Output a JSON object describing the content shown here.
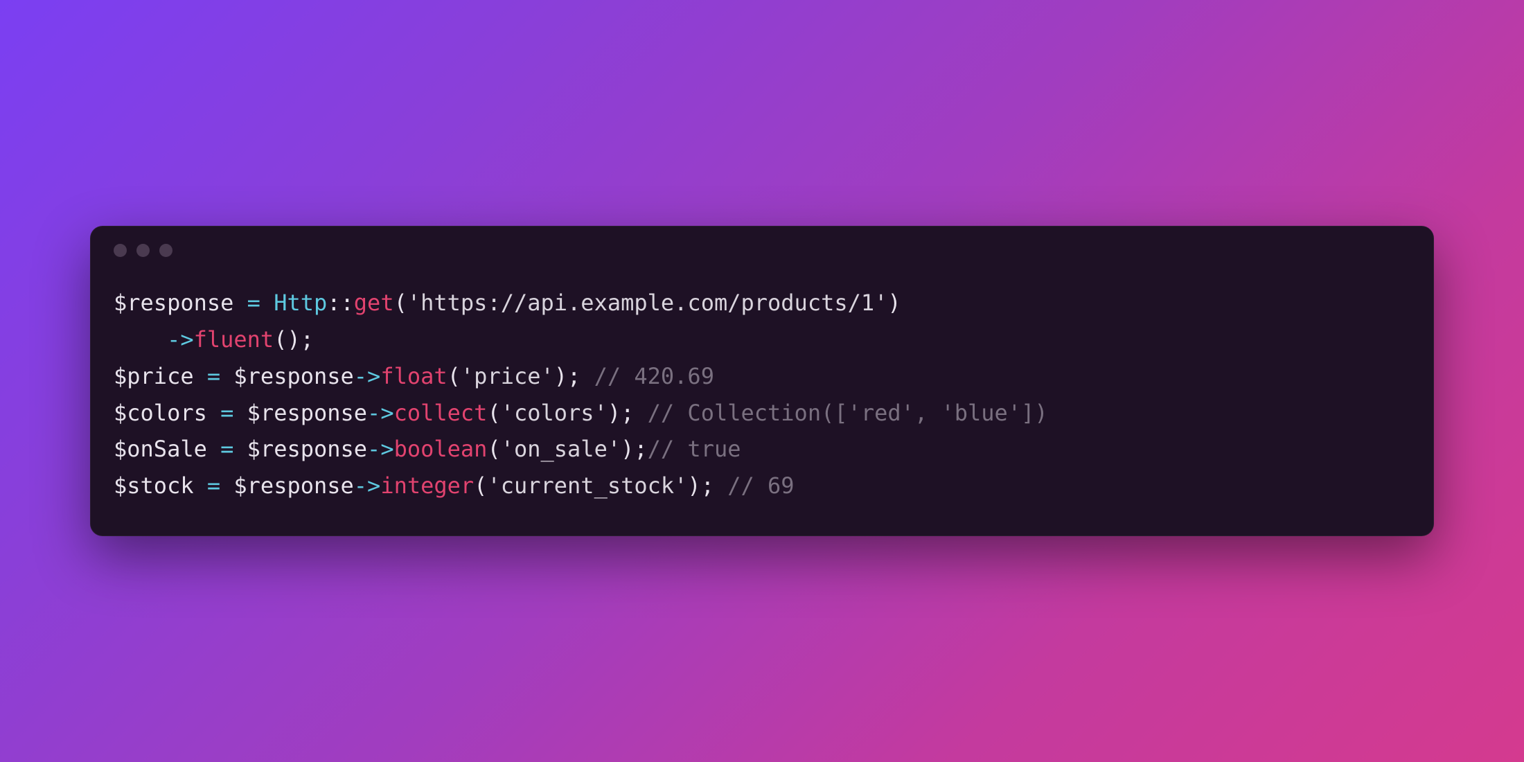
{
  "code": {
    "lines": [
      {
        "indent": "",
        "segments": [
          {
            "cls": "tok-var",
            "t": "$response"
          },
          {
            "cls": "tok-punct",
            "t": " "
          },
          {
            "cls": "tok-op",
            "t": "="
          },
          {
            "cls": "tok-punct",
            "t": " "
          },
          {
            "cls": "tok-class",
            "t": "Http"
          },
          {
            "cls": "tok-punct",
            "t": "::"
          },
          {
            "cls": "tok-method",
            "t": "get"
          },
          {
            "cls": "tok-punct",
            "t": "("
          },
          {
            "cls": "tok-string",
            "t": "'https://api.example.com/products/1'"
          },
          {
            "cls": "tok-punct",
            "t": ")"
          }
        ]
      },
      {
        "indent": "    ",
        "segments": [
          {
            "cls": "tok-op",
            "t": "->"
          },
          {
            "cls": "tok-method",
            "t": "fluent"
          },
          {
            "cls": "tok-punct",
            "t": "();"
          }
        ]
      },
      {
        "indent": "",
        "segments": [
          {
            "cls": "tok-var",
            "t": "$price"
          },
          {
            "cls": "tok-punct",
            "t": " "
          },
          {
            "cls": "tok-op",
            "t": "="
          },
          {
            "cls": "tok-punct",
            "t": " "
          },
          {
            "cls": "tok-var",
            "t": "$response"
          },
          {
            "cls": "tok-op",
            "t": "->"
          },
          {
            "cls": "tok-method",
            "t": "float"
          },
          {
            "cls": "tok-punct",
            "t": "("
          },
          {
            "cls": "tok-string",
            "t": "'price'"
          },
          {
            "cls": "tok-punct",
            "t": "); "
          },
          {
            "cls": "tok-comment",
            "t": "// 420.69"
          }
        ]
      },
      {
        "indent": "",
        "segments": [
          {
            "cls": "tok-var",
            "t": "$colors"
          },
          {
            "cls": "tok-punct",
            "t": " "
          },
          {
            "cls": "tok-op",
            "t": "="
          },
          {
            "cls": "tok-punct",
            "t": " "
          },
          {
            "cls": "tok-var",
            "t": "$response"
          },
          {
            "cls": "tok-op",
            "t": "->"
          },
          {
            "cls": "tok-method",
            "t": "collect"
          },
          {
            "cls": "tok-punct",
            "t": "("
          },
          {
            "cls": "tok-string",
            "t": "'colors'"
          },
          {
            "cls": "tok-punct",
            "t": "); "
          },
          {
            "cls": "tok-comment",
            "t": "// Collection(['red', 'blue'])"
          }
        ]
      },
      {
        "indent": "",
        "segments": [
          {
            "cls": "tok-var",
            "t": "$onSale"
          },
          {
            "cls": "tok-punct",
            "t": " "
          },
          {
            "cls": "tok-op",
            "t": "="
          },
          {
            "cls": "tok-punct",
            "t": " "
          },
          {
            "cls": "tok-var",
            "t": "$response"
          },
          {
            "cls": "tok-op",
            "t": "->"
          },
          {
            "cls": "tok-method",
            "t": "boolean"
          },
          {
            "cls": "tok-punct",
            "t": "("
          },
          {
            "cls": "tok-string",
            "t": "'on_sale'"
          },
          {
            "cls": "tok-punct",
            "t": ");"
          },
          {
            "cls": "tok-comment",
            "t": "// true"
          }
        ]
      },
      {
        "indent": "",
        "segments": [
          {
            "cls": "tok-var",
            "t": "$stock"
          },
          {
            "cls": "tok-punct",
            "t": " "
          },
          {
            "cls": "tok-op",
            "t": "="
          },
          {
            "cls": "tok-punct",
            "t": " "
          },
          {
            "cls": "tok-var",
            "t": "$response"
          },
          {
            "cls": "tok-op",
            "t": "->"
          },
          {
            "cls": "tok-method",
            "t": "integer"
          },
          {
            "cls": "tok-punct",
            "t": "("
          },
          {
            "cls": "tok-string",
            "t": "'current_stock'"
          },
          {
            "cls": "tok-punct",
            "t": "); "
          },
          {
            "cls": "tok-comment",
            "t": "// 69"
          }
        ]
      }
    ]
  }
}
